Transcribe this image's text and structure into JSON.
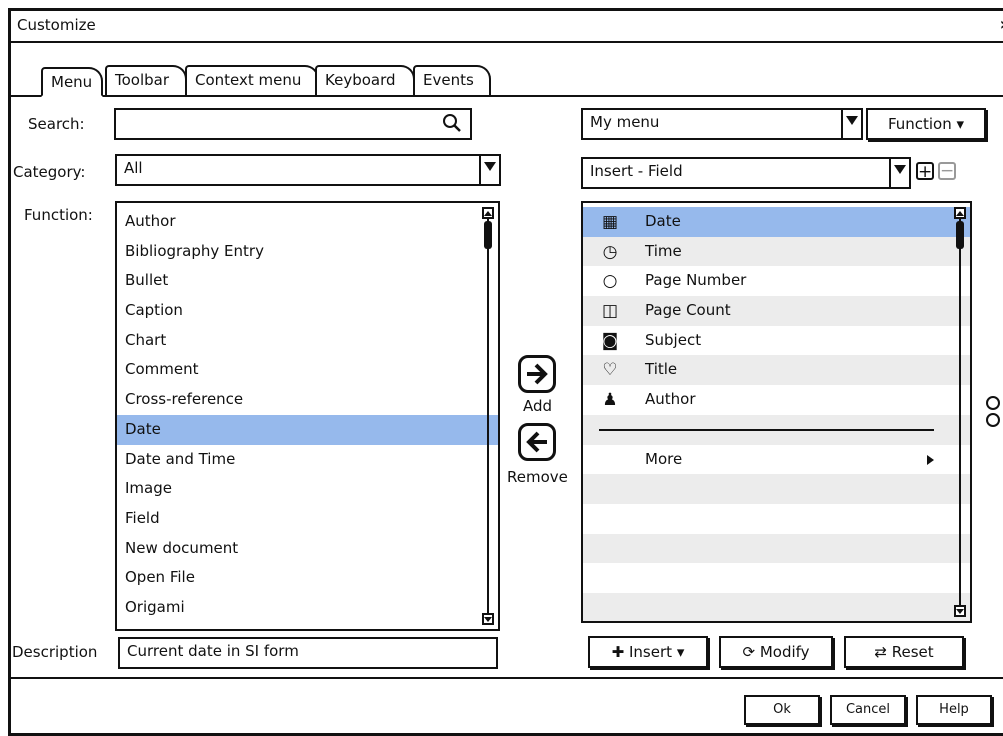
{
  "window": {
    "title": "Customize",
    "close_glyph": "✕"
  },
  "tabs": [
    {
      "label": "Menu",
      "active": true
    },
    {
      "label": "Toolbar"
    },
    {
      "label": "Context menu"
    },
    {
      "label": "Keyboard"
    },
    {
      "label": "Events"
    }
  ],
  "left": {
    "search_label": "Search:",
    "search_value": "",
    "category_label": "Category:",
    "category_value": "All",
    "function_label": "Function:",
    "functions": [
      "Author",
      "Bibliography Entry",
      "Bullet",
      "Caption",
      "Chart",
      "Comment",
      "Cross-reference",
      "Date",
      "Date and Time",
      "Image",
      "Field",
      "New document",
      "Open File",
      "Origami"
    ],
    "selected_function": "Date",
    "description_label": "Description",
    "description_value": "Current date in SI form"
  },
  "middle": {
    "add_label": "Add",
    "remove_label": "Remove"
  },
  "right": {
    "menu_value": "My menu",
    "function_button": "Function",
    "submenu_value": "Insert - Field",
    "items": [
      {
        "label": "Date",
        "icon": "calendar-icon",
        "selected": true
      },
      {
        "label": "Time",
        "icon": "clock-icon"
      },
      {
        "label": "Page Number",
        "icon": "circle-icon"
      },
      {
        "label": "Page Count",
        "icon": "columns-icon"
      },
      {
        "label": "Subject",
        "icon": "camera-icon"
      },
      {
        "label": "Title",
        "icon": "heart-icon"
      },
      {
        "label": "Author",
        "icon": "user-icon"
      },
      {
        "label": "",
        "separator": true
      },
      {
        "label": "More",
        "submenu": true
      }
    ],
    "insert_button": "Insert",
    "modify_button": "Modify",
    "reset_button": "Reset"
  },
  "footer": {
    "ok": "Ok",
    "cancel": "Cancel",
    "help": "Help"
  },
  "colors": {
    "selection": "#96b9ec",
    "alt_row": "#ececec"
  }
}
